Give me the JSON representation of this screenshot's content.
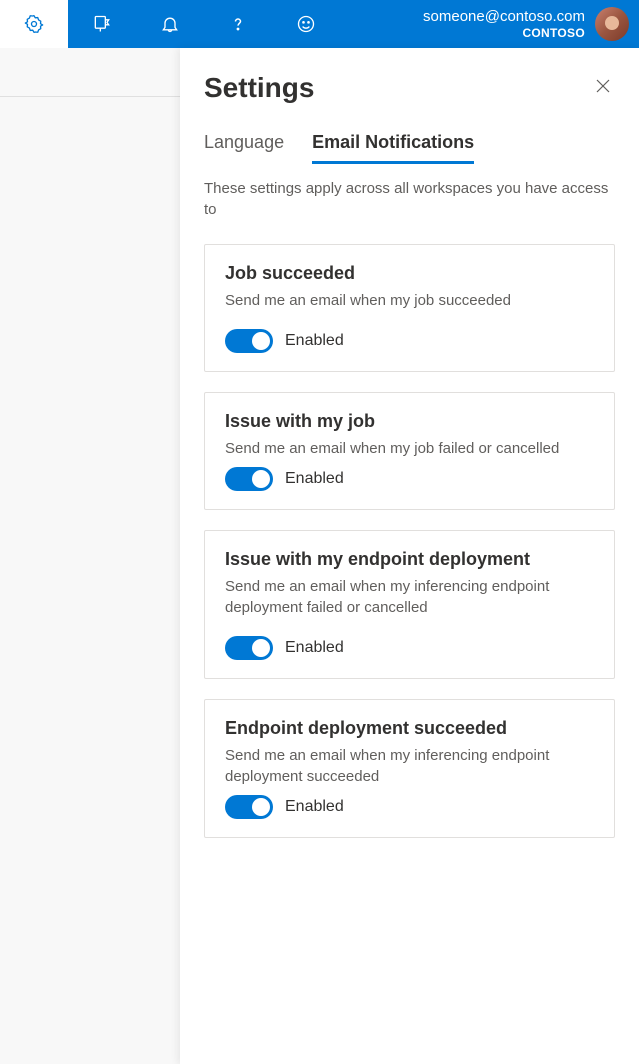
{
  "header": {
    "user_email": "someone@contoso.com",
    "org": "CONTOSO"
  },
  "panel": {
    "title": "Settings",
    "tabs": {
      "language": "Language",
      "email_notifications": "Email Notifications"
    },
    "description": "These settings apply across all workspaces you have access to",
    "cards": [
      {
        "title": "Job succeeded",
        "desc": "Send me an email when my job succeeded",
        "toggle_label": "Enabled",
        "enabled": true
      },
      {
        "title": "Issue with my job",
        "desc": "Send me an email when my job failed or cancelled",
        "toggle_label": "Enabled",
        "enabled": true
      },
      {
        "title": "Issue with my endpoint deployment",
        "desc": "Send me an email when my inferencing endpoint deployment failed or cancelled",
        "toggle_label": "Enabled",
        "enabled": true
      },
      {
        "title": "Endpoint deployment succeeded",
        "desc": "Send me an email when my inferencing endpoint deployment succeeded",
        "toggle_label": "Enabled",
        "enabled": true
      }
    ]
  }
}
